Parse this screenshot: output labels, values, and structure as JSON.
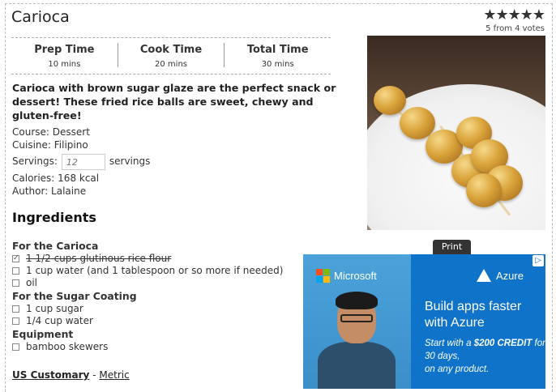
{
  "recipe": {
    "title": "Carioca",
    "rating_stars": "★★★★★",
    "rating_votes": "5 from 4 votes",
    "times": [
      {
        "label": "Prep Time",
        "value": "10 mins"
      },
      {
        "label": "Cook Time",
        "value": "20 mins"
      },
      {
        "label": "Total Time",
        "value": "30 mins"
      }
    ],
    "summary": "Carioca with brown sugar glaze are the perfect snack or dessert! These fried rice balls are sweet, chewy and gluten-free!",
    "course": "Course: Dessert",
    "cuisine": "Cuisine: Filipino",
    "servings_label": "Servings:",
    "servings_placeholder": "12",
    "servings_unit": "servings",
    "calories": "Calories: 168 kcal",
    "author": "Author: Lalaine"
  },
  "ingredients": {
    "heading": "Ingredients",
    "groups": [
      {
        "name": "For the Carioca",
        "items": [
          "1 1/2 cups glutinous rice flour",
          "1 cup water (and 1 tablespoon or so more if needed)",
          "oil"
        ]
      },
      {
        "name": "For the Sugar Coating",
        "items": [
          "1 cup sugar",
          "1/4 cup water"
        ]
      },
      {
        "name": "Equipment",
        "items": [
          "bamboo skewers"
        ]
      }
    ],
    "checked_item": "1 1/2 cups glutinous rice flour"
  },
  "units": {
    "us": "US Customary",
    "sep": "-",
    "metric": "Metric"
  },
  "print_label": "Print",
  "ad": {
    "ms_brand": "Microsoft",
    "az_brand": "Azure",
    "headline_1": "Build apps faster",
    "headline_2": "with Azure",
    "sub_1": "Start with a ",
    "sub_bold": "$200 CREDIT",
    "sub_2": " for 30 days,",
    "sub_3": "on any product.",
    "adchoices_icon": "ad-choices-icon"
  },
  "colors": {
    "ms_red": "#f25022",
    "ms_green": "#7fba00",
    "ms_blue": "#00a4ef",
    "ms_yellow": "#ffb900",
    "azure_blue": "#0e73c9"
  }
}
